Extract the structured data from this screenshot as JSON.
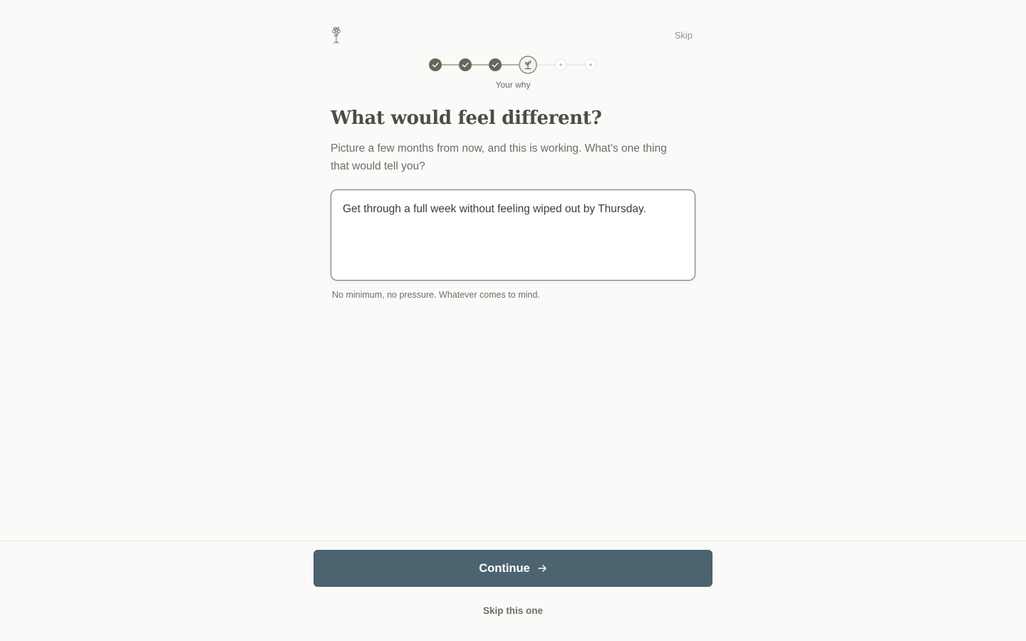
{
  "header": {
    "logo_icon": "tree-icon",
    "skip_label": "Skip"
  },
  "stepper": {
    "current_step": 4,
    "total_steps": 6,
    "completed_steps": 3,
    "current_label": "Your why",
    "current_icon": "sprout-icon",
    "completed_icon": "check-icon",
    "colors": {
      "completed": "#5f6b58",
      "line": "#dcdcd6",
      "upcoming": "#b9bcb4"
    }
  },
  "question": {
    "heading": "What would feel different?",
    "subtext": "Picture a few months from now, and this is working. What’s one thing that would tell you?",
    "answer_value": "Get through a full week without feeling wiped out by Thursday.",
    "hint": "No minimum, no pressure. Whatever comes to mind."
  },
  "footer": {
    "continue_label": "Continue",
    "continue_icon": "arrow-right-icon",
    "skip_one_label": "Skip this one",
    "primary_color": "#4c6370"
  }
}
